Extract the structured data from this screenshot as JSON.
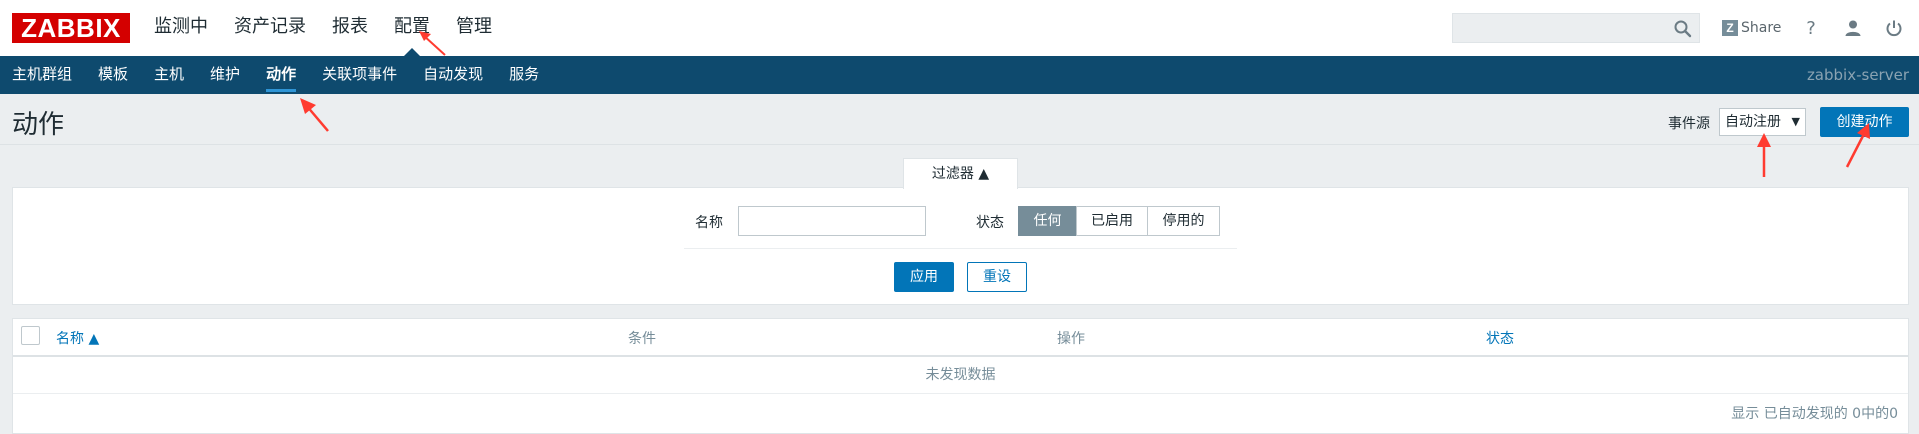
{
  "brand": "ZABBIX",
  "main_menu": [
    "监测中",
    "资产记录",
    "报表",
    "配置",
    "管理"
  ],
  "main_menu_selected": "配置",
  "header_icons": {
    "search": "search-icon",
    "share_label": "Share",
    "share_badge": "Z",
    "help": "?",
    "user": "user-icon",
    "logout": "power-icon"
  },
  "sub_menu": [
    "主机群组",
    "模板",
    "主机",
    "维护",
    "动作",
    "关联项事件",
    "自动发现",
    "服务"
  ],
  "sub_menu_selected": "动作",
  "server_name": "zabbix-server",
  "page_title": "动作",
  "event_source": {
    "label": "事件源",
    "value": "自动注册",
    "caret": "▼"
  },
  "create_button": "创建动作",
  "filter": {
    "tab_label": "过滤器 ▲",
    "name_label": "名称",
    "name_value": "",
    "status_label": "状态",
    "status_options": [
      "任何",
      "已启用",
      "停用的"
    ],
    "status_selected": "任何",
    "apply": "应用",
    "reset": "重设"
  },
  "table": {
    "columns": [
      "名称 ▲",
      "条件",
      "操作",
      "状态"
    ],
    "empty_text": "未发现数据",
    "footer": "显示 已自动发现的 0中的0"
  },
  "colors": {
    "brand_red": "#d40000",
    "nav_blue": "#0e4a6e",
    "accent_blue": "#0275b8",
    "annotation_red": "#ff3b30"
  }
}
